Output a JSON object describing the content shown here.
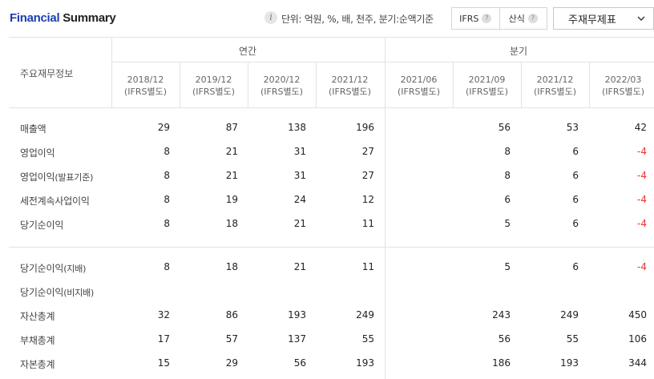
{
  "header": {
    "title_part1": "Financial",
    "title_part2": "Summary",
    "info_icon_glyph": "i",
    "unit_text": "단위: 억원, %, 배, 천주, 분기:순액기준",
    "standards": [
      {
        "label": "IFRS",
        "help": "?"
      },
      {
        "label": "산식",
        "help": "?"
      }
    ],
    "view_select": "주재무제표"
  },
  "table": {
    "row_header_label": "주요재무정보",
    "groups": {
      "annual": "연간",
      "quarterly": "분기"
    },
    "columns": [
      {
        "period": "2018/12",
        "basis": "(IFRS별도)"
      },
      {
        "period": "2019/12",
        "basis": "(IFRS별도)"
      },
      {
        "period": "2020/12",
        "basis": "(IFRS별도)"
      },
      {
        "period": "2021/12",
        "basis": "(IFRS별도)"
      },
      {
        "period": "2021/06",
        "basis": "(IFRS별도)"
      },
      {
        "period": "2021/09",
        "basis": "(IFRS별도)"
      },
      {
        "period": "2021/12",
        "basis": "(IFRS별도)"
      },
      {
        "period": "2022/03",
        "basis": "(IFRS별도)"
      }
    ],
    "rows": [
      {
        "label": "매출액",
        "suffix": "",
        "values": [
          "29",
          "87",
          "138",
          "196",
          "56",
          "53",
          "42"
        ]
      },
      {
        "label": "영업이익",
        "suffix": "",
        "values": [
          "8",
          "21",
          "31",
          "27",
          "8",
          "6",
          "-4"
        ]
      },
      {
        "label": "영업이익",
        "suffix": "(발표기준)",
        "values": [
          "8",
          "21",
          "31",
          "27",
          "8",
          "6",
          "-4"
        ]
      },
      {
        "label": "세전계속사업이익",
        "suffix": "",
        "values": [
          "8",
          "19",
          "24",
          "12",
          "6",
          "6",
          "-4"
        ]
      },
      {
        "label": "당기순이익",
        "suffix": "",
        "values": [
          "8",
          "18",
          "21",
          "11",
          "5",
          "6",
          "-4"
        ]
      },
      {
        "label": "당기순이익",
        "suffix": "(지배)",
        "values": [
          "8",
          "18",
          "21",
          "11",
          "5",
          "6",
          "-4"
        ]
      },
      {
        "label": "당기순이익",
        "suffix": "(비지배)",
        "values": [
          "",
          "",
          "",
          "",
          "",
          "",
          ""
        ]
      },
      {
        "label": "자산총계",
        "suffix": "",
        "values": [
          "32",
          "86",
          "193",
          "249",
          "243",
          "249",
          "450"
        ]
      },
      {
        "label": "부채총계",
        "suffix": "",
        "values": [
          "17",
          "57",
          "137",
          "55",
          "56",
          "55",
          "106"
        ]
      },
      {
        "label": "자본총계",
        "suffix": "",
        "values": [
          "15",
          "29",
          "56",
          "193",
          "186",
          "193",
          "344"
        ]
      }
    ]
  },
  "colors": {
    "title_accent": "#1a3fb0",
    "negative": "#e8332b",
    "border": "#e3e3e3"
  }
}
